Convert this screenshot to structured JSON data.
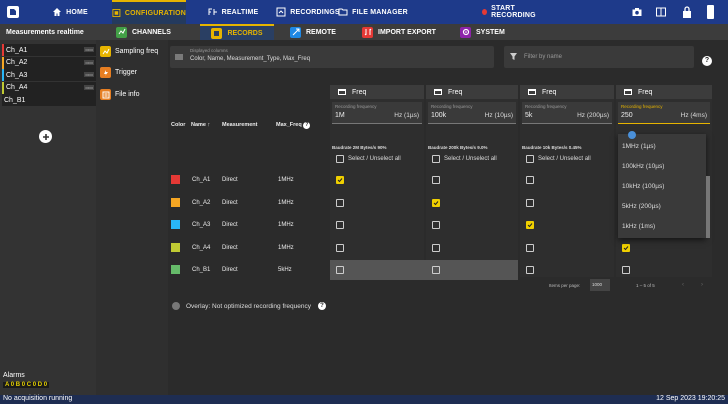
{
  "topnav": {
    "home": "HOME",
    "configuration": "CONFIGURATION",
    "realtime": "REALTIME",
    "recordings": "RECORDINGS",
    "file_manager": "FILE MANAGER",
    "start_recording": "START RECORDING"
  },
  "subnav": {
    "measurements_realtime": "Measurements realtime",
    "channels": "CHANNELS",
    "records": "RECORDS",
    "remote": "REMOTE",
    "import_export": "IMPORT EXPORT",
    "system": "SYSTEM"
  },
  "channels_list": [
    "Ch_A1",
    "Ch_A2",
    "Ch_A3",
    "Ch_A4",
    "Ch_B1"
  ],
  "config_menu": {
    "sampling_freq": "Sampling freq",
    "trigger": "Trigger",
    "file_info": "File info"
  },
  "filter": {
    "displayed_columns_label": "Displayed columns",
    "displayed_columns_value": "Color, Name, Measurement_Type, Max_Freq",
    "filter_placeholder": "Filter by name"
  },
  "columns": {
    "color": "Color",
    "name": "Name",
    "measurement": "Measurement",
    "max_freq": "Max_Freq"
  },
  "freq_cols": [
    {
      "header": "Freq",
      "rec_label": "Recording frequency",
      "value": "1M",
      "unit": "Hz (1µs)",
      "baudrate": "Baudrate 2M Bytes/s 90%",
      "select_all": "Select / Unselect all"
    },
    {
      "header": "Freq",
      "rec_label": "Recording frequency",
      "value": "100k",
      "unit": "Hz (10µs)",
      "baudrate": "Baudrate 200k Bytes/s 9.0%",
      "select_all": "Select / Unselect all"
    },
    {
      "header": "Freq",
      "rec_label": "Recording frequency",
      "value": "5k",
      "unit": "Hz (200µs)",
      "baudrate": "Baudrate 10k Bytes/s 0.45%",
      "select_all": "Select / Unselect all"
    },
    {
      "header": "Freq",
      "rec_label": "Recording frequency",
      "value": "250",
      "unit": "Hz (4ms)"
    }
  ],
  "rows": [
    {
      "name": "Ch_A1",
      "measurement": "Direct",
      "max_freq": "1MHz",
      "color": "#e53935"
    },
    {
      "name": "Ch_A2",
      "measurement": "Direct",
      "max_freq": "1MHz",
      "color": "#f5a623"
    },
    {
      "name": "Ch_A3",
      "measurement": "Direct",
      "max_freq": "1MHz",
      "color": "#29b6f6"
    },
    {
      "name": "Ch_A4",
      "measurement": "Direct",
      "max_freq": "1MHz",
      "color": "#c0ca33"
    },
    {
      "name": "Ch_B1",
      "measurement": "Direct",
      "max_freq": "5kHz",
      "color": "#66bb6a"
    }
  ],
  "dropdown_options": [
    "1MHz (1µs)",
    "100kHz (10µs)",
    "10kHz (100µs)",
    "5kHz (200µs)",
    "1kHz (1ms)"
  ],
  "pagination": {
    "items_per_page_label": "Items per page:",
    "items_per_page": "1000",
    "range": "1 – 5 of 5"
  },
  "overlay_text": "Overlay: Not optimized recording frequency",
  "alarms": {
    "label": "Alarms",
    "letters": "A 0 B 0 C 0 D 0"
  },
  "status": {
    "left": "No acquisition running",
    "right": "12 Sep 2023 19:20:25"
  }
}
